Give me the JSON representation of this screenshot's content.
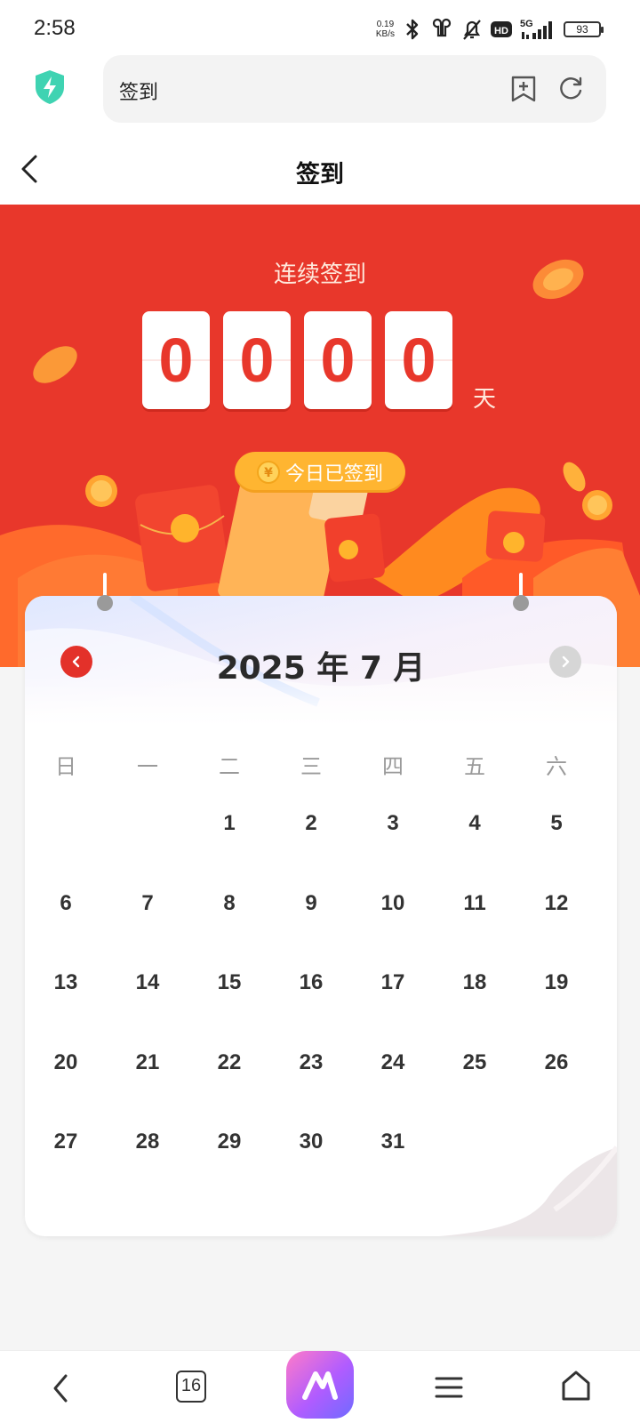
{
  "status_bar": {
    "time": "2:58",
    "net_speed_value": "0.19",
    "net_speed_unit": "KB/s",
    "hd_label": "HD",
    "network_label": "5G",
    "battery": "93"
  },
  "browser": {
    "url_text": "签到"
  },
  "header": {
    "title": "签到"
  },
  "hero": {
    "streak_label": "连续签到",
    "streak_digits": [
      "0",
      "0",
      "0",
      "0"
    ],
    "unit": "天",
    "status_badge": "今日已签到",
    "coin_symbol": "¥"
  },
  "calendar": {
    "month_title": "2025 年 7 月",
    "weekdays": [
      "日",
      "一",
      "二",
      "三",
      "四",
      "五",
      "六"
    ],
    "weeks": [
      [
        "",
        "",
        "1",
        "2",
        "3",
        "4",
        "5"
      ],
      [
        "6",
        "7",
        "8",
        "9",
        "10",
        "11",
        "12"
      ],
      [
        "13",
        "14",
        "15",
        "16",
        "17",
        "18",
        "19"
      ],
      [
        "20",
        "21",
        "22",
        "23",
        "24",
        "25",
        "26"
      ],
      [
        "27",
        "28",
        "29",
        "30",
        "31",
        "",
        ""
      ]
    ]
  },
  "bottom_nav": {
    "tab_count": "16"
  },
  "colors": {
    "hero_red": "#e8372b",
    "badge_yellow": "#ffb531",
    "prev_button": "#e3312a",
    "next_button_disabled": "#d6d6d6"
  },
  "icons": [
    "shield-bolt-icon",
    "bluetooth-icon",
    "earbuds-icon",
    "mute-bell-icon",
    "signal-icon",
    "bookmark-add-icon",
    "refresh-icon",
    "back-icon",
    "coin-icon",
    "chevron-left-icon",
    "chevron-right-icon",
    "menu-icon",
    "home-icon"
  ]
}
